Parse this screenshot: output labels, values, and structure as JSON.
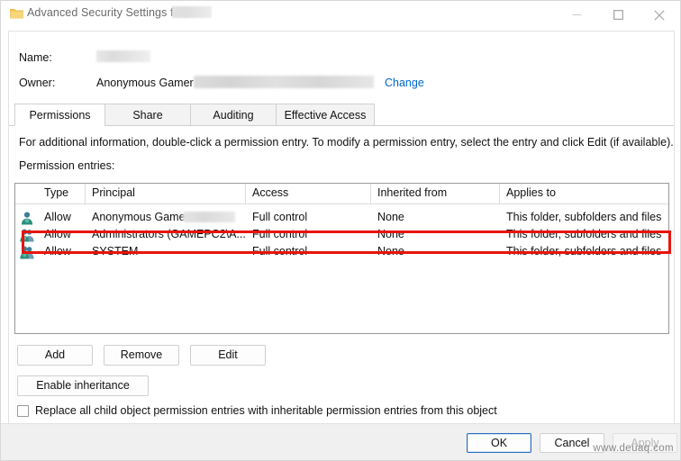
{
  "window": {
    "title": "Advanced Security Settings for",
    "title_redacted": true,
    "folder_icon": "folder-icon",
    "controls": {
      "minimize": "minimize-icon",
      "maximize": "maximize-icon",
      "close": "close-icon"
    }
  },
  "fields": {
    "name_label": "Name:",
    "name_value": "",
    "name_redacted": true,
    "owner_label": "Owner:",
    "owner_value": "Anonymous Gamer",
    "owner_redacted": true,
    "change_link": "Change"
  },
  "tabs": [
    {
      "label": "Permissions",
      "active": true
    },
    {
      "label": "Share",
      "active": false
    },
    {
      "label": "Auditing",
      "active": false
    },
    {
      "label": "Effective Access",
      "active": false
    }
  ],
  "description": "For additional information, double-click a permission entry. To modify a permission entry, select the entry and click Edit (if available).",
  "entries_label": "Permission entries:",
  "table": {
    "columns": [
      "Type",
      "Principal",
      "Access",
      "Inherited from",
      "Applies to"
    ],
    "rows": [
      {
        "icon": "user-icon",
        "type": "Allow",
        "principal": "Anonymous Gamer",
        "principal_redacted": true,
        "access": "Full control",
        "inherited_from": "None",
        "applies_to": "This folder, subfolders and files",
        "highlighted": true
      },
      {
        "icon": "group-icon",
        "type": "Allow",
        "principal": "Administrators (GAMEPC2\\A...",
        "principal_redacted": false,
        "access": "Full control",
        "inherited_from": "None",
        "applies_to": "This folder, subfolders and files",
        "highlighted": false
      },
      {
        "icon": "group-icon",
        "type": "Allow",
        "principal": "SYSTEM",
        "principal_redacted": false,
        "access": "Full control",
        "inherited_from": "None",
        "applies_to": "This folder, subfolders and files",
        "highlighted": false
      }
    ]
  },
  "buttons": {
    "add": "Add",
    "remove": "Remove",
    "edit": "Edit",
    "enable_inheritance": "Enable inheritance"
  },
  "replace_checkbox": {
    "label": "Replace all child object permission entries with inheritable permission entries from this object",
    "checked": false
  },
  "footer": {
    "ok": "OK",
    "cancel": "Cancel",
    "apply": "Apply",
    "apply_disabled": true
  },
  "watermark": "www.deuaq.com",
  "colors": {
    "accent_link": "#0066cc",
    "highlight_box": "#e8140c",
    "focus_border": "#2a6fc0",
    "disabled_text": "#b5b5b5"
  }
}
